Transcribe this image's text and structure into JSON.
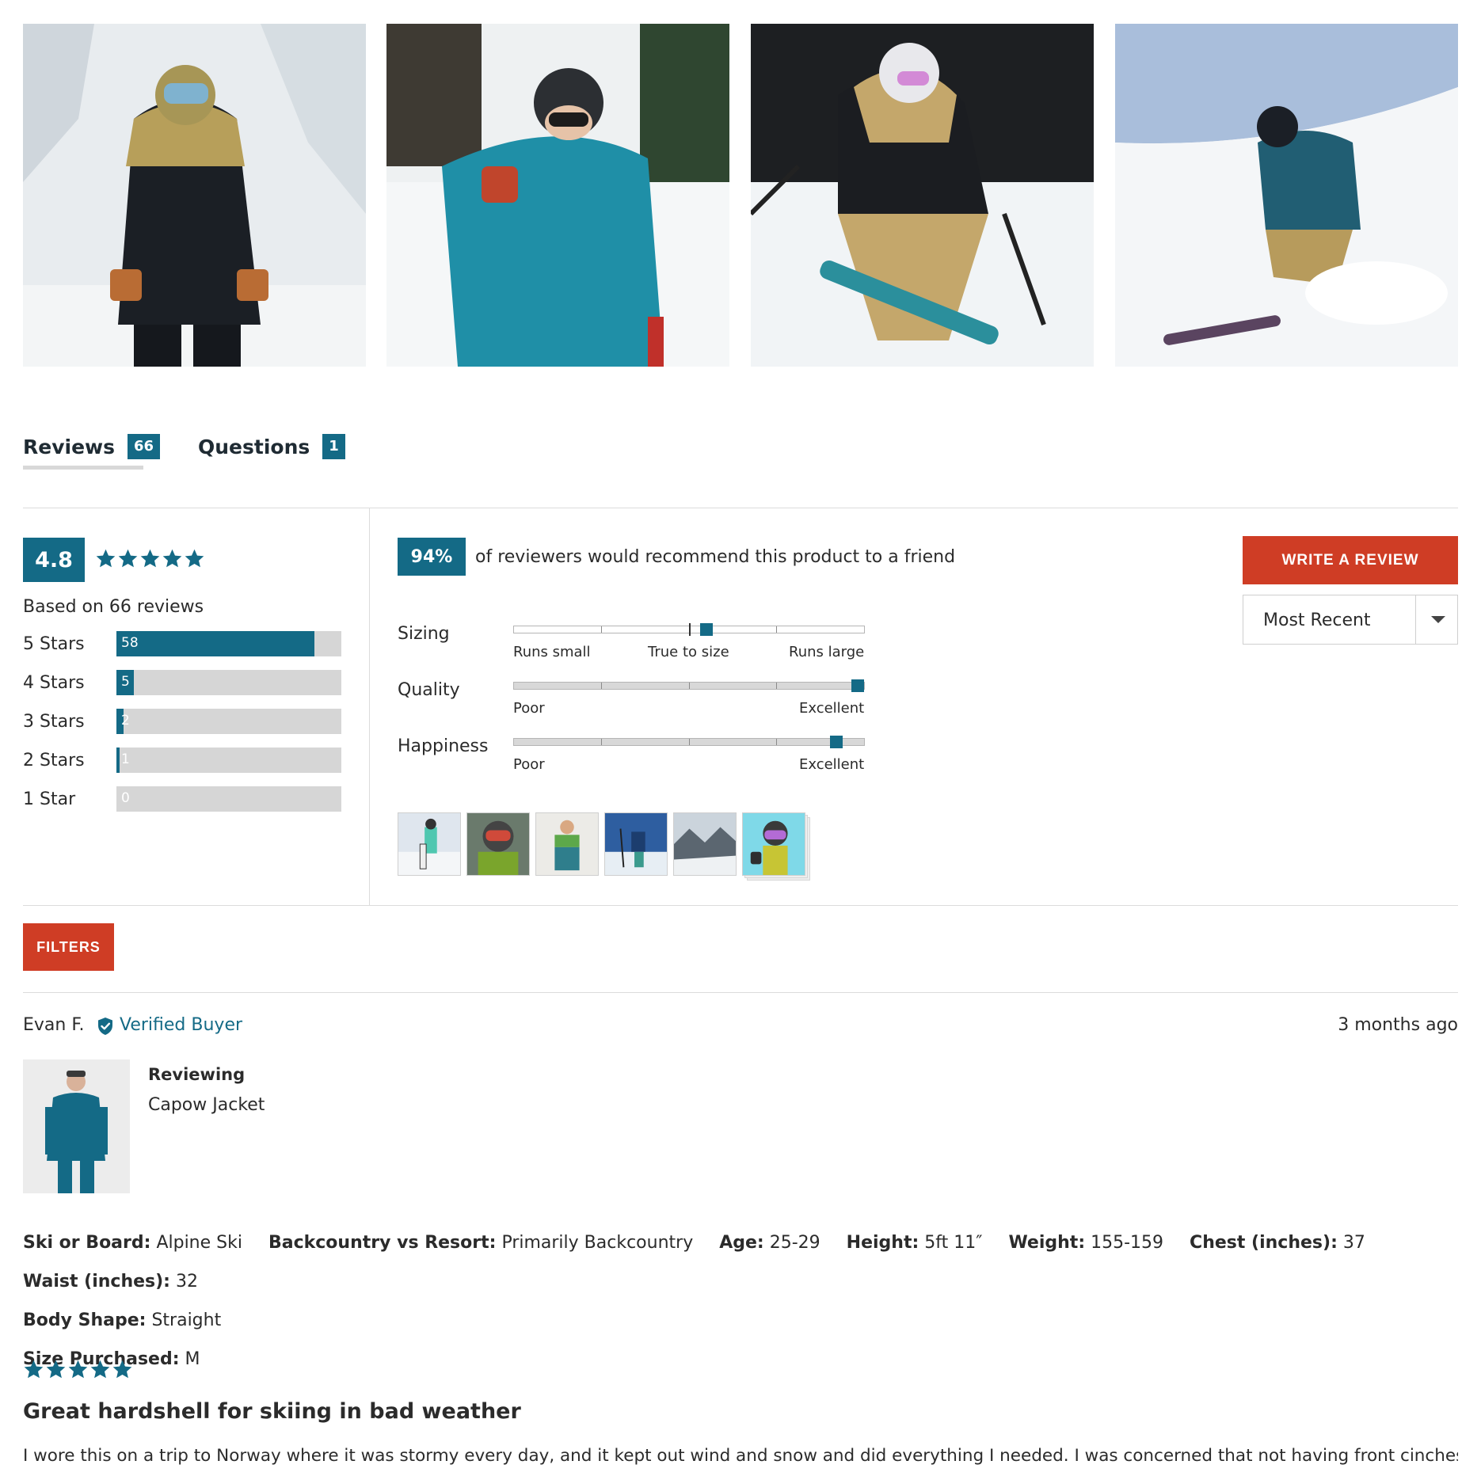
{
  "colors": {
    "accent": "#146a86",
    "cta": "#cf3d25",
    "bar_bg": "#d6d6d6"
  },
  "gallery": [
    {
      "icon": "skier-photo-1"
    },
    {
      "icon": "skier-photo-2"
    },
    {
      "icon": "skier-photo-3"
    },
    {
      "icon": "skier-photo-4"
    }
  ],
  "tabs": [
    {
      "label": "Reviews",
      "count": "66",
      "active": true
    },
    {
      "label": "Questions",
      "count": "1",
      "active": false
    }
  ],
  "summary": {
    "average": "4.8",
    "stars": 5,
    "based_on": "Based on 66 reviews",
    "distribution": [
      {
        "label": "5 Stars",
        "count": "58",
        "fraction": 0.879
      },
      {
        "label": "4 Stars",
        "count": "5",
        "fraction": 0.076
      },
      {
        "label": "3 Stars",
        "count": "2",
        "fraction": 0.03
      },
      {
        "label": "2 Stars",
        "count": "1",
        "fraction": 0.015
      },
      {
        "label": "1 Star",
        "count": "0",
        "fraction": 0.0
      }
    ]
  },
  "recommend": {
    "percent": "94%",
    "text": "of reviewers would recommend this product to a friend"
  },
  "sliders": [
    {
      "name": "Sizing",
      "labels": [
        "Runs small",
        "True to size",
        "Runs large"
      ],
      "value": 0.55
    },
    {
      "name": "Quality",
      "labels": [
        "Poor",
        "Excellent"
      ],
      "value": 0.99
    },
    {
      "name": "Happiness",
      "labels": [
        "Poor",
        "Excellent"
      ],
      "value": 0.92
    }
  ],
  "thumbnails": 6,
  "actions": {
    "write_review": "WRITE A REVIEW",
    "sort_selected": "Most Recent",
    "filters": "FILTERS"
  },
  "review": {
    "reviewer": "Evan F.",
    "verified": "Verified Buyer",
    "time": "3 months ago",
    "reviewing_label": "Reviewing",
    "product": "Capow Jacket",
    "attributes": [
      [
        {
          "k": "Ski or Board:",
          "v": "Alpine Ski"
        },
        {
          "k": "Backcountry vs Resort:",
          "v": "Primarily Backcountry"
        },
        {
          "k": "Age:",
          "v": "25-29"
        },
        {
          "k": "Height:",
          "v": "5ft 11″"
        },
        {
          "k": "Weight:",
          "v": "155-159"
        },
        {
          "k": "Chest (inches):",
          "v": "37"
        },
        {
          "k": "Waist (inches):",
          "v": "32"
        }
      ],
      [
        {
          "k": "Body Shape:",
          "v": "Straight"
        }
      ],
      [
        {
          "k": "Size Purchased:",
          "v": "M"
        }
      ]
    ],
    "stars": 5,
    "title": "Great hardshell for skiing in bad weather",
    "body": "I wore this on a trip to Norway where it was stormy every day, and it kept out wind and snow and did everything I needed. I was concerned that not having front cinches"
  }
}
